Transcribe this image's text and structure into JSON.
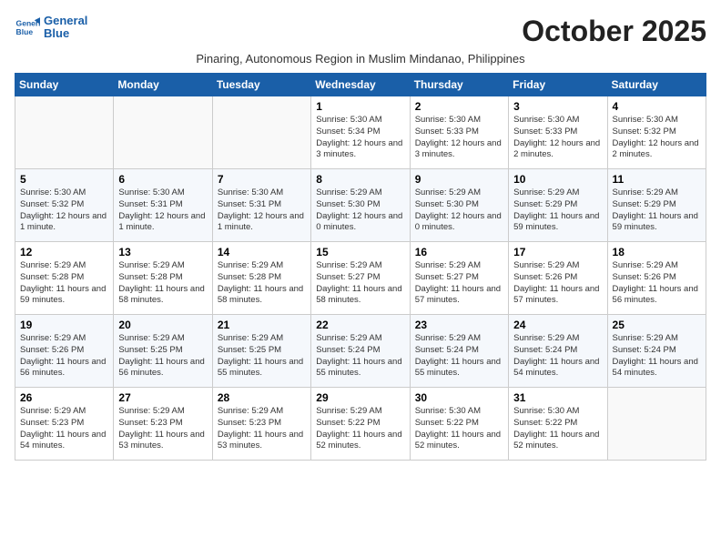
{
  "header": {
    "logo_line1": "General",
    "logo_line2": "Blue",
    "month_title": "October 2025",
    "subtitle": "Pinaring, Autonomous Region in Muslim Mindanao, Philippines"
  },
  "weekdays": [
    "Sunday",
    "Monday",
    "Tuesday",
    "Wednesday",
    "Thursday",
    "Friday",
    "Saturday"
  ],
  "weeks": [
    [
      {
        "day": "",
        "sunrise": "",
        "sunset": "",
        "daylight": ""
      },
      {
        "day": "",
        "sunrise": "",
        "sunset": "",
        "daylight": ""
      },
      {
        "day": "",
        "sunrise": "",
        "sunset": "",
        "daylight": ""
      },
      {
        "day": "1",
        "sunrise": "Sunrise: 5:30 AM",
        "sunset": "Sunset: 5:34 PM",
        "daylight": "Daylight: 12 hours and 3 minutes."
      },
      {
        "day": "2",
        "sunrise": "Sunrise: 5:30 AM",
        "sunset": "Sunset: 5:33 PM",
        "daylight": "Daylight: 12 hours and 3 minutes."
      },
      {
        "day": "3",
        "sunrise": "Sunrise: 5:30 AM",
        "sunset": "Sunset: 5:33 PM",
        "daylight": "Daylight: 12 hours and 2 minutes."
      },
      {
        "day": "4",
        "sunrise": "Sunrise: 5:30 AM",
        "sunset": "Sunset: 5:32 PM",
        "daylight": "Daylight: 12 hours and 2 minutes."
      }
    ],
    [
      {
        "day": "5",
        "sunrise": "Sunrise: 5:30 AM",
        "sunset": "Sunset: 5:32 PM",
        "daylight": "Daylight: 12 hours and 1 minute."
      },
      {
        "day": "6",
        "sunrise": "Sunrise: 5:30 AM",
        "sunset": "Sunset: 5:31 PM",
        "daylight": "Daylight: 12 hours and 1 minute."
      },
      {
        "day": "7",
        "sunrise": "Sunrise: 5:30 AM",
        "sunset": "Sunset: 5:31 PM",
        "daylight": "Daylight: 12 hours and 1 minute."
      },
      {
        "day": "8",
        "sunrise": "Sunrise: 5:29 AM",
        "sunset": "Sunset: 5:30 PM",
        "daylight": "Daylight: 12 hours and 0 minutes."
      },
      {
        "day": "9",
        "sunrise": "Sunrise: 5:29 AM",
        "sunset": "Sunset: 5:30 PM",
        "daylight": "Daylight: 12 hours and 0 minutes."
      },
      {
        "day": "10",
        "sunrise": "Sunrise: 5:29 AM",
        "sunset": "Sunset: 5:29 PM",
        "daylight": "Daylight: 11 hours and 59 minutes."
      },
      {
        "day": "11",
        "sunrise": "Sunrise: 5:29 AM",
        "sunset": "Sunset: 5:29 PM",
        "daylight": "Daylight: 11 hours and 59 minutes."
      }
    ],
    [
      {
        "day": "12",
        "sunrise": "Sunrise: 5:29 AM",
        "sunset": "Sunset: 5:28 PM",
        "daylight": "Daylight: 11 hours and 59 minutes."
      },
      {
        "day": "13",
        "sunrise": "Sunrise: 5:29 AM",
        "sunset": "Sunset: 5:28 PM",
        "daylight": "Daylight: 11 hours and 58 minutes."
      },
      {
        "day": "14",
        "sunrise": "Sunrise: 5:29 AM",
        "sunset": "Sunset: 5:28 PM",
        "daylight": "Daylight: 11 hours and 58 minutes."
      },
      {
        "day": "15",
        "sunrise": "Sunrise: 5:29 AM",
        "sunset": "Sunset: 5:27 PM",
        "daylight": "Daylight: 11 hours and 58 minutes."
      },
      {
        "day": "16",
        "sunrise": "Sunrise: 5:29 AM",
        "sunset": "Sunset: 5:27 PM",
        "daylight": "Daylight: 11 hours and 57 minutes."
      },
      {
        "day": "17",
        "sunrise": "Sunrise: 5:29 AM",
        "sunset": "Sunset: 5:26 PM",
        "daylight": "Daylight: 11 hours and 57 minutes."
      },
      {
        "day": "18",
        "sunrise": "Sunrise: 5:29 AM",
        "sunset": "Sunset: 5:26 PM",
        "daylight": "Daylight: 11 hours and 56 minutes."
      }
    ],
    [
      {
        "day": "19",
        "sunrise": "Sunrise: 5:29 AM",
        "sunset": "Sunset: 5:26 PM",
        "daylight": "Daylight: 11 hours and 56 minutes."
      },
      {
        "day": "20",
        "sunrise": "Sunrise: 5:29 AM",
        "sunset": "Sunset: 5:25 PM",
        "daylight": "Daylight: 11 hours and 56 minutes."
      },
      {
        "day": "21",
        "sunrise": "Sunrise: 5:29 AM",
        "sunset": "Sunset: 5:25 PM",
        "daylight": "Daylight: 11 hours and 55 minutes."
      },
      {
        "day": "22",
        "sunrise": "Sunrise: 5:29 AM",
        "sunset": "Sunset: 5:24 PM",
        "daylight": "Daylight: 11 hours and 55 minutes."
      },
      {
        "day": "23",
        "sunrise": "Sunrise: 5:29 AM",
        "sunset": "Sunset: 5:24 PM",
        "daylight": "Daylight: 11 hours and 55 minutes."
      },
      {
        "day": "24",
        "sunrise": "Sunrise: 5:29 AM",
        "sunset": "Sunset: 5:24 PM",
        "daylight": "Daylight: 11 hours and 54 minutes."
      },
      {
        "day": "25",
        "sunrise": "Sunrise: 5:29 AM",
        "sunset": "Sunset: 5:24 PM",
        "daylight": "Daylight: 11 hours and 54 minutes."
      }
    ],
    [
      {
        "day": "26",
        "sunrise": "Sunrise: 5:29 AM",
        "sunset": "Sunset: 5:23 PM",
        "daylight": "Daylight: 11 hours and 54 minutes."
      },
      {
        "day": "27",
        "sunrise": "Sunrise: 5:29 AM",
        "sunset": "Sunset: 5:23 PM",
        "daylight": "Daylight: 11 hours and 53 minutes."
      },
      {
        "day": "28",
        "sunrise": "Sunrise: 5:29 AM",
        "sunset": "Sunset: 5:23 PM",
        "daylight": "Daylight: 11 hours and 53 minutes."
      },
      {
        "day": "29",
        "sunrise": "Sunrise: 5:29 AM",
        "sunset": "Sunset: 5:22 PM",
        "daylight": "Daylight: 11 hours and 52 minutes."
      },
      {
        "day": "30",
        "sunrise": "Sunrise: 5:30 AM",
        "sunset": "Sunset: 5:22 PM",
        "daylight": "Daylight: 11 hours and 52 minutes."
      },
      {
        "day": "31",
        "sunrise": "Sunrise: 5:30 AM",
        "sunset": "Sunset: 5:22 PM",
        "daylight": "Daylight: 11 hours and 52 minutes."
      },
      {
        "day": "",
        "sunrise": "",
        "sunset": "",
        "daylight": ""
      }
    ]
  ]
}
